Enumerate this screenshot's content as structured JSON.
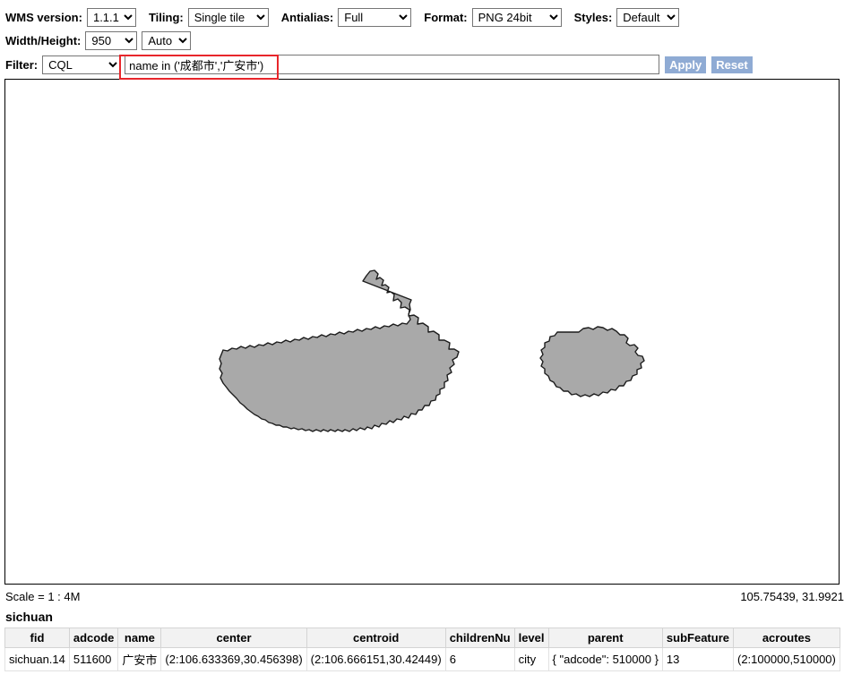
{
  "toolbar": {
    "wms_version_label": "WMS version:",
    "wms_version_value": "1.1.1",
    "tiling_label": "Tiling:",
    "tiling_value": "Single tile",
    "antialias_label": "Antialias:",
    "antialias_value": "Full",
    "format_label": "Format:",
    "format_value": "PNG 24bit",
    "styles_label": "Styles:",
    "styles_value": "Default",
    "width_height_label": "Width/Height:",
    "width_value": "950",
    "height_value": "Auto"
  },
  "filter": {
    "label": "Filter:",
    "type_value": "CQL",
    "expression": "name in ('成都市','广安市')",
    "apply_label": "Apply",
    "reset_label": "Reset"
  },
  "map": {
    "options_icon": "options-icon",
    "options_glyph": "▪▪▪",
    "zoom_in_label": "+",
    "zoom_out_label": "−",
    "scale_text": "Scale = 1 : 4M",
    "coordinates": "105.75439, 31.9921",
    "fill_color": "#a9a9a9",
    "stroke_color": "#1a1a1a",
    "background_color": "#ffffff"
  },
  "result": {
    "layer_name": "sichuan",
    "columns": [
      "fid",
      "adcode",
      "name",
      "center",
      "centroid",
      "childrenNu",
      "level",
      "parent",
      "subFeature",
      "acroutes"
    ],
    "rows": [
      {
        "fid": "sichuan.14",
        "adcode": "511600",
        "name": "广安市",
        "center": "(2:106.633369,30.456398)",
        "centroid": "(2:106.666151,30.42449)",
        "childrenNu": "6",
        "level": "city",
        "parent": "{ \"adcode\": 510000 }",
        "subFeature": "13",
        "acroutes": "(2:100000,510000)"
      }
    ]
  }
}
